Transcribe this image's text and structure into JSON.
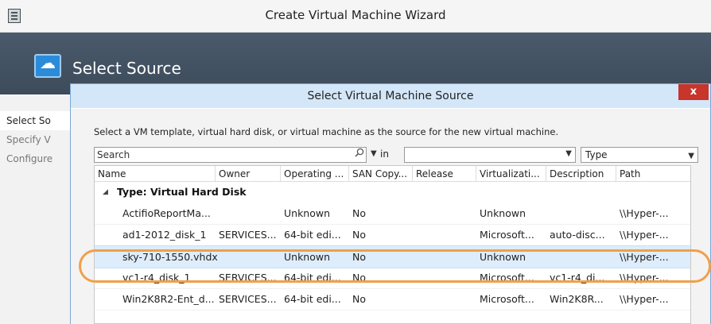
{
  "window": {
    "title": "Create Virtual Machine Wizard"
  },
  "header": {
    "title": "Select Source"
  },
  "nav": {
    "items": [
      "Select So",
      "Specify V",
      "Configure"
    ]
  },
  "dialog": {
    "title": "Select Virtual Machine Source",
    "close_label": "x",
    "instruction": "Select a VM template, virtual hard disk, or virtual machine as the source for the new virtual machine.",
    "search_placeholder": "Search",
    "in_label": "in",
    "combo1_value": "",
    "combo2_value": "Type"
  },
  "grid": {
    "columns": [
      "Name",
      "Owner",
      "Operating ...",
      "SAN Copy...",
      "Release",
      "Virtualizati...",
      "Description",
      "Path"
    ],
    "group_label": "Type: Virtual Hard Disk",
    "rows": [
      [
        "ActifioReportMa...",
        "",
        "Unknown",
        "No",
        "",
        "Unknown",
        "",
        "\\\\Hyper-..."
      ],
      [
        "ad1-2012_disk_1",
        "SERVICES...",
        "64-bit edi...",
        "No",
        "",
        "Microsoft...",
        "auto-disc...",
        "\\\\Hyper-..."
      ],
      [
        "sky-710-1550.vhdx",
        "",
        "Unknown",
        "No",
        "",
        "Unknown",
        "",
        "\\\\Hyper-..."
      ],
      [
        "vc1-r4_disk_1",
        "SERVICES...",
        "64-bit edi...",
        "No",
        "",
        "Microsoft...",
        "vc1-r4_di...",
        "\\\\Hyper-..."
      ],
      [
        "Win2K8R2-Ent_d...",
        "SERVICES...",
        "64-bit edi...",
        "No",
        "",
        "Microsoft...",
        "Win2K8R...",
        "\\\\Hyper-..."
      ]
    ],
    "selected_row": 2
  },
  "colors": {
    "selection": "#deedfb",
    "highlight": "#f0a04b",
    "close": "#c7352b"
  }
}
